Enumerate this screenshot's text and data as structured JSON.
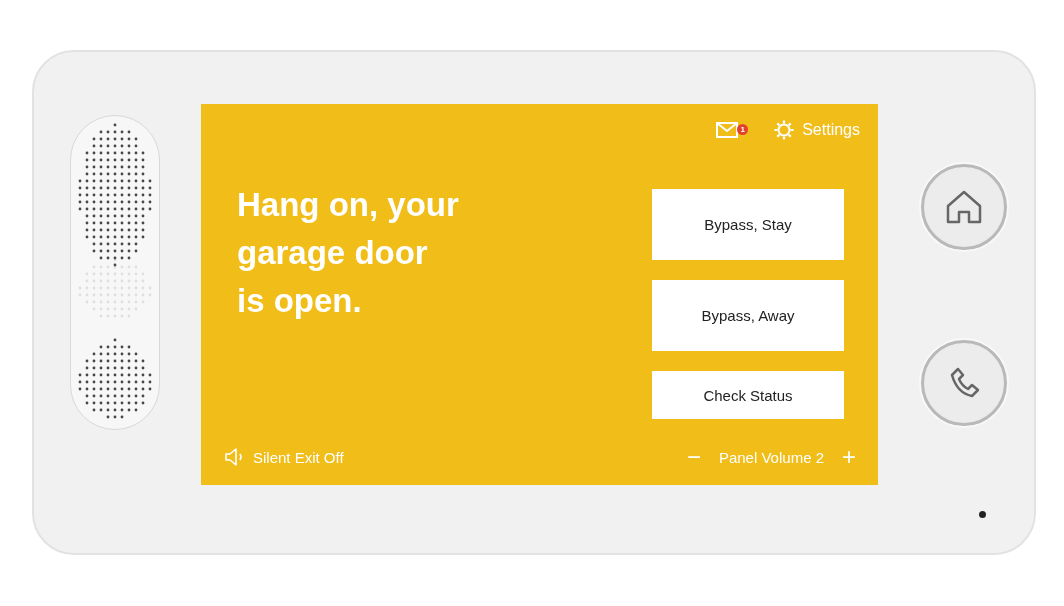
{
  "header": {
    "messages": {
      "badge": "1"
    },
    "settings": "Settings"
  },
  "message": [
    "Hang on, your",
    "garage door",
    "is open."
  ],
  "actions": [
    {
      "label": "Bypass, Stay",
      "kind": "tall"
    },
    {
      "label": "Bypass, Away",
      "kind": "tall"
    },
    {
      "label": "Check Status",
      "kind": "short"
    }
  ],
  "footer": {
    "silent_exit": "Silent Exit Off",
    "volume": {
      "minus": "−",
      "label": "Panel Volume 2",
      "plus": "+"
    }
  },
  "hardware_buttons": [
    {
      "kind": "home"
    },
    {
      "kind": "phone"
    }
  ]
}
